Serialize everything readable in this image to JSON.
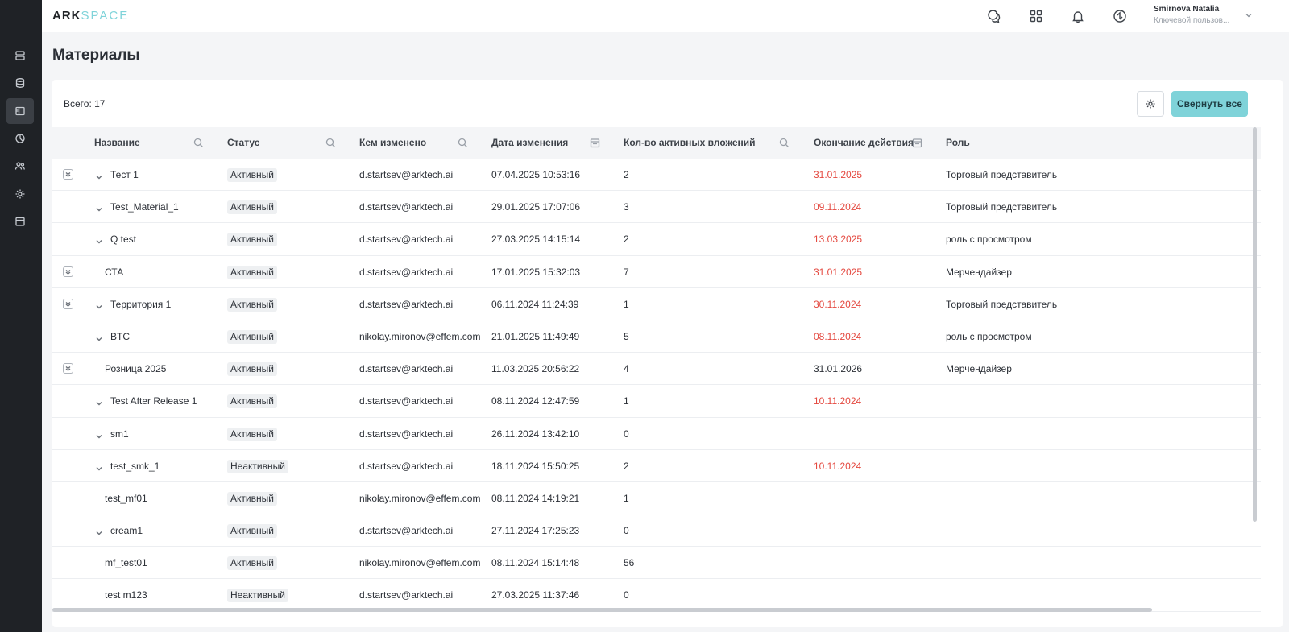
{
  "app": {
    "logo_ark": "ARK",
    "logo_space": "SPACE"
  },
  "user": {
    "name": "Smirnova Natalia",
    "role": "Ключевой пользов..."
  },
  "page": {
    "title": "Материалы",
    "total": "Всего: 17",
    "collapse_all": "Свернуть все"
  },
  "columns": [
    {
      "label": "Название",
      "filter": "search-icon"
    },
    {
      "label": "Статус",
      "filter": "search-icon"
    },
    {
      "label": "Кем изменено",
      "filter": "search-icon"
    },
    {
      "label": "Дата изменения",
      "filter": "calendar-icon"
    },
    {
      "label": "Кол-во активных вложений",
      "filter": "search-icon"
    },
    {
      "label": "Окончание действия",
      "filter": "calendar-icon"
    },
    {
      "label": "Роль",
      "filter": ""
    }
  ],
  "rows": [
    {
      "expand_box": true,
      "chevron": true,
      "name": "Тест 1",
      "status": "Активный",
      "changed_by": "d.startsev@arktech.ai",
      "changed_at": "07.04.2025 10:53:16",
      "attachments": "2",
      "end_date": "31.01.2025",
      "expired": true,
      "role": "Торговый представитель"
    },
    {
      "expand_box": false,
      "chevron": true,
      "name": "Test_Material_1",
      "status": "Активный",
      "changed_by": "d.startsev@arktech.ai",
      "changed_at": "29.01.2025 17:07:06",
      "attachments": "3",
      "end_date": "09.11.2024",
      "expired": true,
      "role": "Торговый представитель"
    },
    {
      "expand_box": false,
      "chevron": true,
      "name": "Q test",
      "status": "Активный",
      "changed_by": "d.startsev@arktech.ai",
      "changed_at": "27.03.2025 14:15:14",
      "attachments": "2",
      "end_date": "13.03.2025",
      "expired": true,
      "role": "роль с просмотром"
    },
    {
      "expand_box": true,
      "chevron": false,
      "name": "СТА",
      "status": "Активный",
      "changed_by": "d.startsev@arktech.ai",
      "changed_at": "17.01.2025 15:32:03",
      "attachments": "7",
      "end_date": "31.01.2025",
      "expired": true,
      "role": "Мерчендайзер"
    },
    {
      "expand_box": true,
      "chevron": true,
      "name": "Территория 1",
      "status": "Активный",
      "changed_by": "d.startsev@arktech.ai",
      "changed_at": "06.11.2024 11:24:39",
      "attachments": "1",
      "end_date": "30.11.2024",
      "expired": true,
      "role": "Торговый представитель"
    },
    {
      "expand_box": false,
      "chevron": true,
      "name": "BTC",
      "status": "Активный",
      "changed_by": "nikolay.mironov@effem.com",
      "changed_at": "21.01.2025 11:49:49",
      "attachments": "5",
      "end_date": "08.11.2024",
      "expired": true,
      "role": "роль с просмотром"
    },
    {
      "expand_box": true,
      "chevron": false,
      "name": "Розница 2025",
      "status": "Активный",
      "changed_by": "d.startsev@arktech.ai",
      "changed_at": "11.03.2025 20:56:22",
      "attachments": "4",
      "end_date": "31.01.2026",
      "expired": false,
      "role": "Мерчендайзер"
    },
    {
      "expand_box": false,
      "chevron": true,
      "name": "Test After Release 1",
      "status": "Активный",
      "changed_by": "d.startsev@arktech.ai",
      "changed_at": "08.11.2024 12:47:59",
      "attachments": "1",
      "end_date": "10.11.2024",
      "expired": true,
      "role": ""
    },
    {
      "expand_box": false,
      "chevron": true,
      "name": "sm1",
      "status": "Активный",
      "changed_by": "d.startsev@arktech.ai",
      "changed_at": "26.11.2024 13:42:10",
      "attachments": "0",
      "end_date": "",
      "expired": false,
      "role": ""
    },
    {
      "expand_box": false,
      "chevron": true,
      "name": "test_smk_1",
      "status": "Неактивный",
      "changed_by": "d.startsev@arktech.ai",
      "changed_at": "18.11.2024 15:50:25",
      "attachments": "2",
      "end_date": "10.11.2024",
      "expired": true,
      "role": ""
    },
    {
      "expand_box": false,
      "chevron": false,
      "name": "test_mf01",
      "status": "Активный",
      "changed_by": "nikolay.mironov@effem.com",
      "changed_at": "08.11.2024 14:19:21",
      "attachments": "1",
      "end_date": "",
      "expired": false,
      "role": ""
    },
    {
      "expand_box": false,
      "chevron": true,
      "name": "cream1",
      "status": "Активный",
      "changed_by": "d.startsev@arktech.ai",
      "changed_at": "27.11.2024 17:25:23",
      "attachments": "0",
      "end_date": "",
      "expired": false,
      "role": ""
    },
    {
      "expand_box": false,
      "chevron": false,
      "name": "mf_test01",
      "status": "Активный",
      "changed_by": "nikolay.mironov@effem.com",
      "changed_at": "08.11.2024 15:14:48",
      "attachments": "56",
      "end_date": "",
      "expired": false,
      "role": ""
    },
    {
      "expand_box": false,
      "chevron": false,
      "name": "test m123",
      "status": "Неактивный",
      "changed_by": "d.startsev@arktech.ai",
      "changed_at": "27.03.2025 11:37:46",
      "attachments": "0",
      "end_date": "",
      "expired": false,
      "role": ""
    }
  ],
  "colors": {
    "accent": "#7fd3d9",
    "sidebar": "#1f2226",
    "expired": "#e4483f"
  },
  "sidebar_icons": [
    "server-icon",
    "database-icon",
    "materials-icon",
    "chart-icon",
    "users-icon",
    "settings-icon",
    "calendar-icon"
  ],
  "header_icons": [
    "chat-icon",
    "apps-grid-icon",
    "bell-icon",
    "sync-icon"
  ]
}
